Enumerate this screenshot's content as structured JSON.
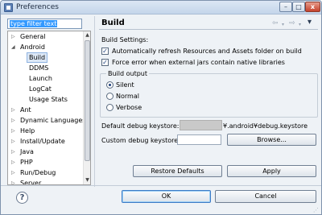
{
  "window": {
    "title": "Preferences"
  },
  "filter": {
    "value": "type filter text"
  },
  "tree": {
    "items": [
      {
        "label": "General",
        "expander": "▷"
      },
      {
        "label": "Android",
        "expander": "◢"
      },
      {
        "label": "Build"
      },
      {
        "label": "DDMS"
      },
      {
        "label": "Launch"
      },
      {
        "label": "LogCat"
      },
      {
        "label": "Usage Stats"
      },
      {
        "label": "Ant",
        "expander": "▷"
      },
      {
        "label": "Dynamic Languages",
        "expander": "▷"
      },
      {
        "label": "Help",
        "expander": "▷"
      },
      {
        "label": "Install/Update",
        "expander": "▷"
      },
      {
        "label": "Java",
        "expander": "▷"
      },
      {
        "label": "PHP",
        "expander": "▷"
      },
      {
        "label": "Run/Debug",
        "expander": "▷"
      },
      {
        "label": "Server",
        "expander": "▷"
      }
    ]
  },
  "page": {
    "title": "Build",
    "build_settings_label": "Build Settings:",
    "auto_refresh": {
      "label": "Automatically refresh Resources and Assets folder on build",
      "checked": true
    },
    "force_error": {
      "label": "Force error when external jars contain native libraries",
      "checked": true
    },
    "build_output": {
      "label": "Build output",
      "options": [
        "Silent",
        "Normal",
        "Verbose"
      ],
      "selected": "Silent"
    },
    "default_keystore": {
      "label": "Default debug keystore:",
      "value": "¥.android¥debug.keystore"
    },
    "custom_keystore": {
      "label": "Custom debug keystore:",
      "value": ""
    },
    "browse_label": "Browse...",
    "restore_defaults_label": "Restore Defaults",
    "apply_label": "Apply"
  },
  "footer": {
    "ok_label": "OK",
    "cancel_label": "Cancel"
  },
  "icons": {
    "help": "?",
    "back": "⇦",
    "forward": "⇨",
    "menu": "▾",
    "close": "x",
    "minimize": "–",
    "maximize": "□",
    "scroll_up": "▲",
    "scroll_down": "▼"
  }
}
